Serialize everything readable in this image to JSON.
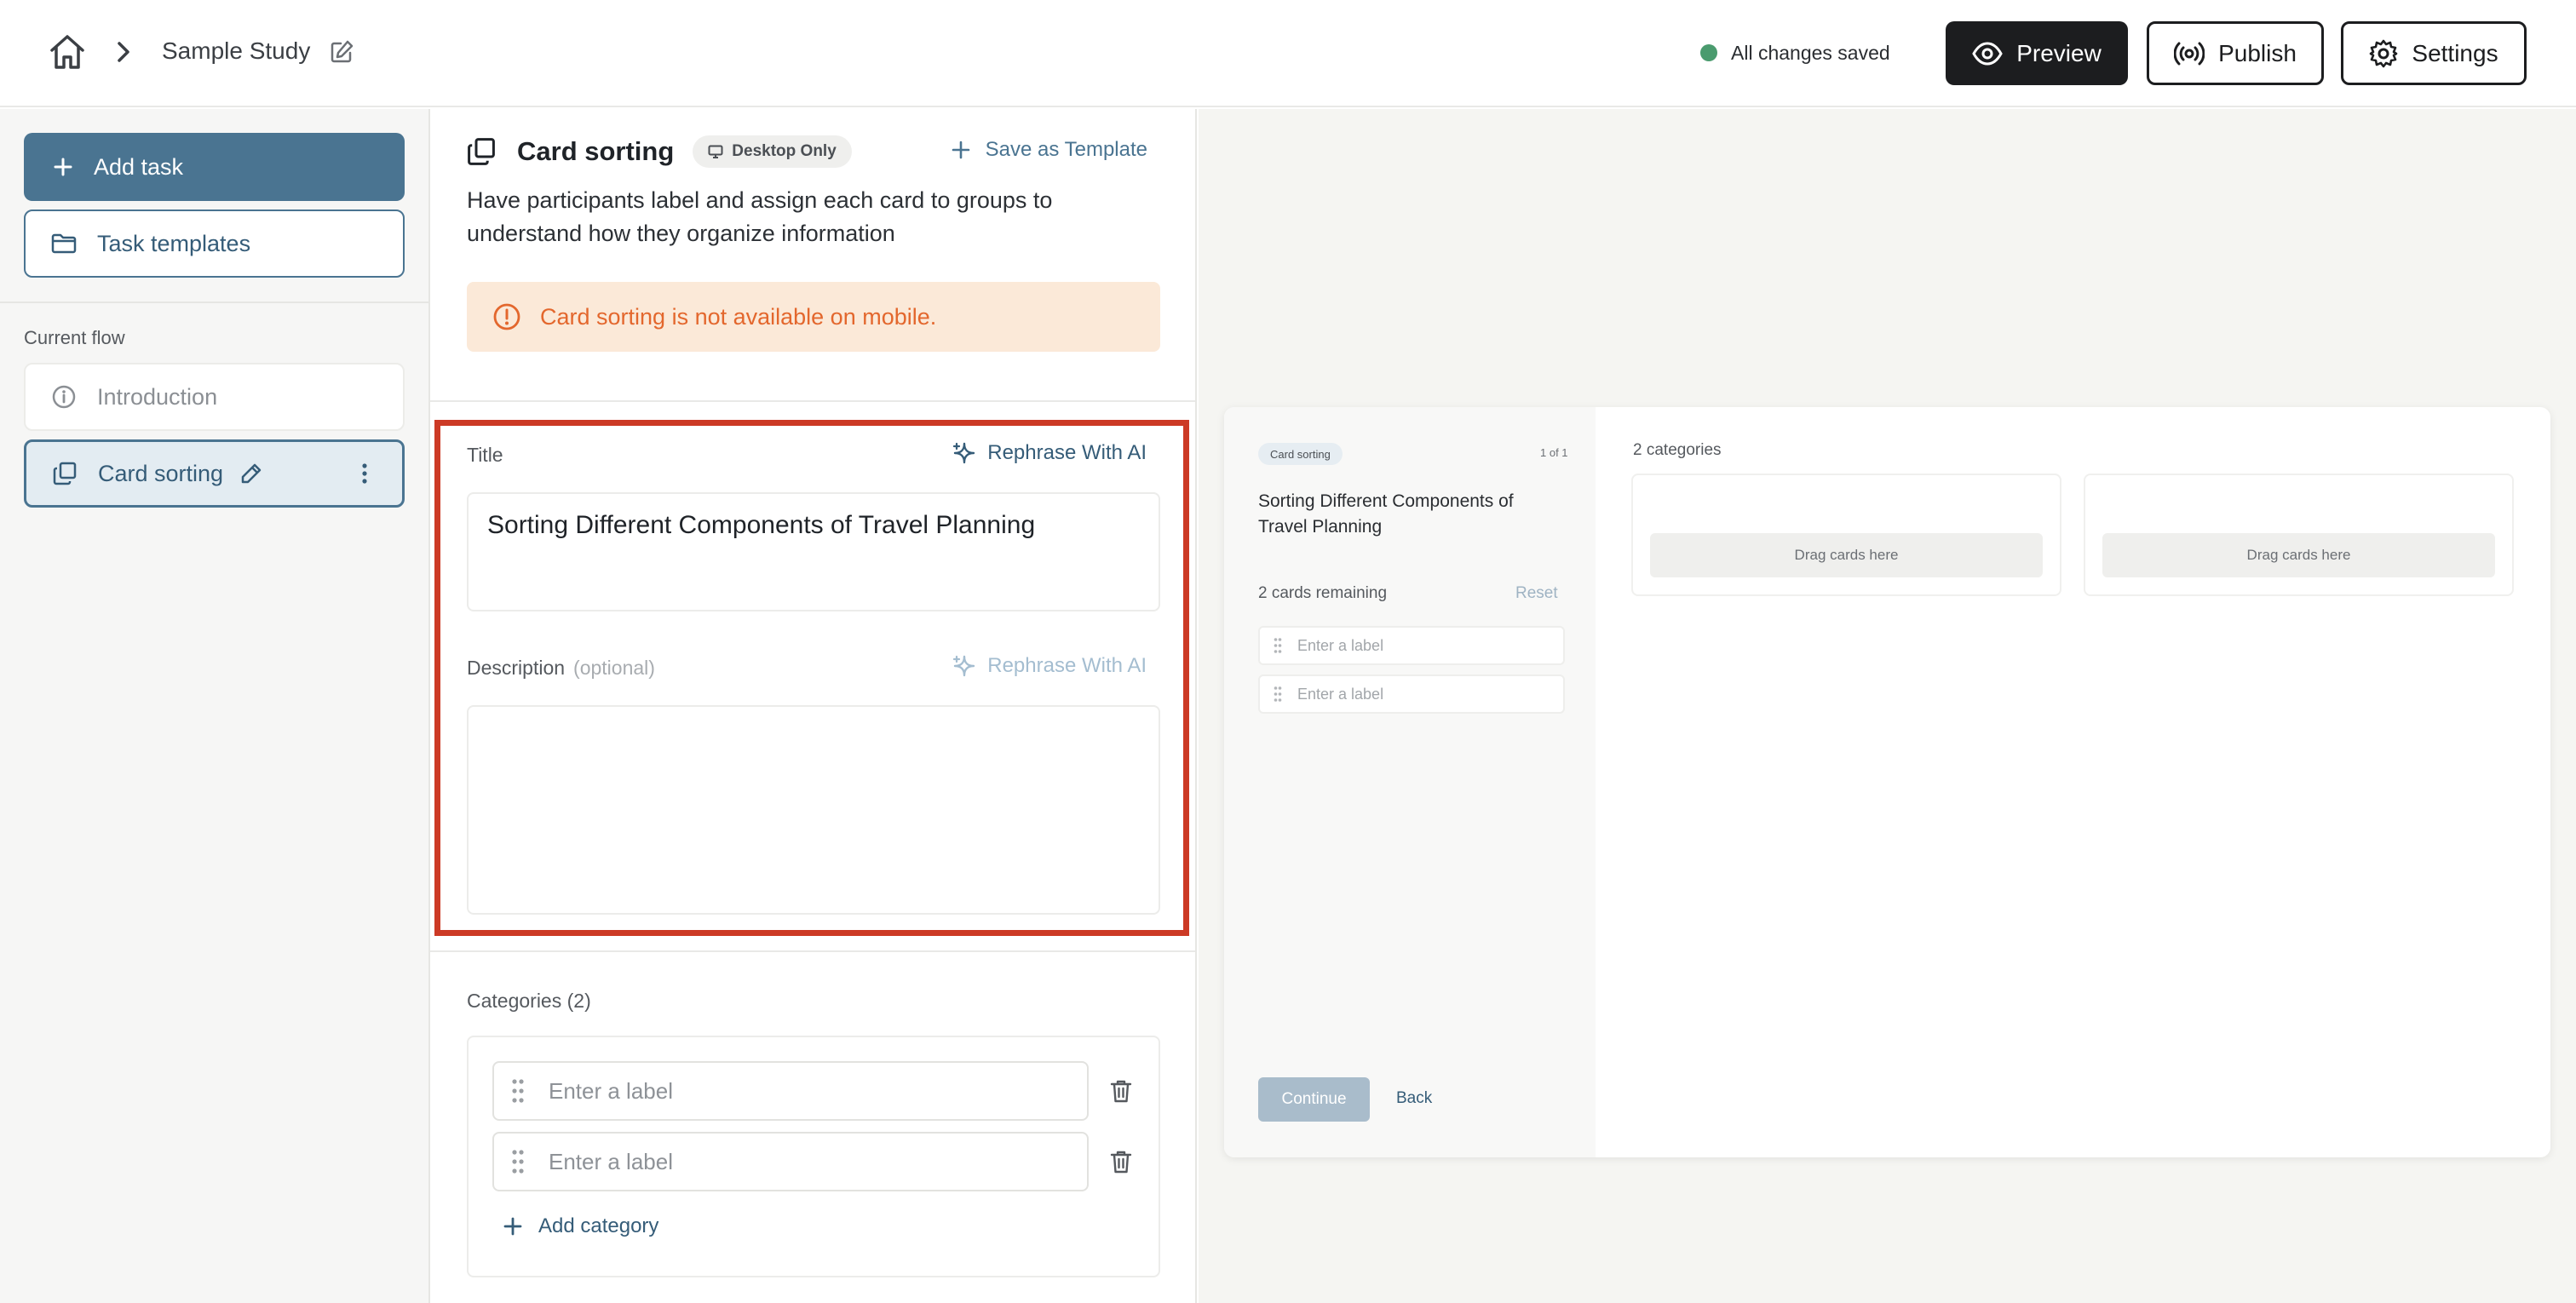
{
  "header": {
    "breadcrumb_study": "Sample Study",
    "save_status": "All changes saved",
    "preview_label": "Preview",
    "publish_label": "Publish",
    "settings_label": "Settings"
  },
  "sidebar": {
    "add_task_label": "Add task",
    "templates_label": "Task templates",
    "flow_heading": "Current flow",
    "flow_items": [
      {
        "label": "Introduction"
      },
      {
        "label": "Card sorting"
      }
    ]
  },
  "editor": {
    "task_title": "Card sorting",
    "badge": "Desktop Only",
    "save_template_label": "Save as Template",
    "description": "Have participants label and assign each card to groups to understand how they organize information",
    "warning": "Card sorting is not available on mobile.",
    "title_label": "Title",
    "rephrase_label": "Rephrase With AI",
    "title_value": "Sorting Different Components of Travel Planning",
    "description_label": "Description",
    "optional_label": "(optional)",
    "description_value": "",
    "categories_label": "Categories (2)",
    "category_placeholder": "Enter a label",
    "add_category_label": "Add category"
  },
  "preview": {
    "badge": "Card sorting",
    "page_count": "1 of 1",
    "title": "Sorting Different Components of Travel Planning",
    "cards_remaining": "2 cards remaining",
    "reset_label": "Reset",
    "card_placeholder": "Enter a label",
    "continue_label": "Continue",
    "back_label": "Back",
    "categories_heading": "2 categories",
    "drop_label": "Drag cards here"
  },
  "colors": {
    "accent": "#4a7491",
    "warning_text": "#e3672d",
    "warning_bg": "#fbe9d8",
    "saved_dot": "#4a9b6e",
    "highlight": "#cc3a25"
  }
}
